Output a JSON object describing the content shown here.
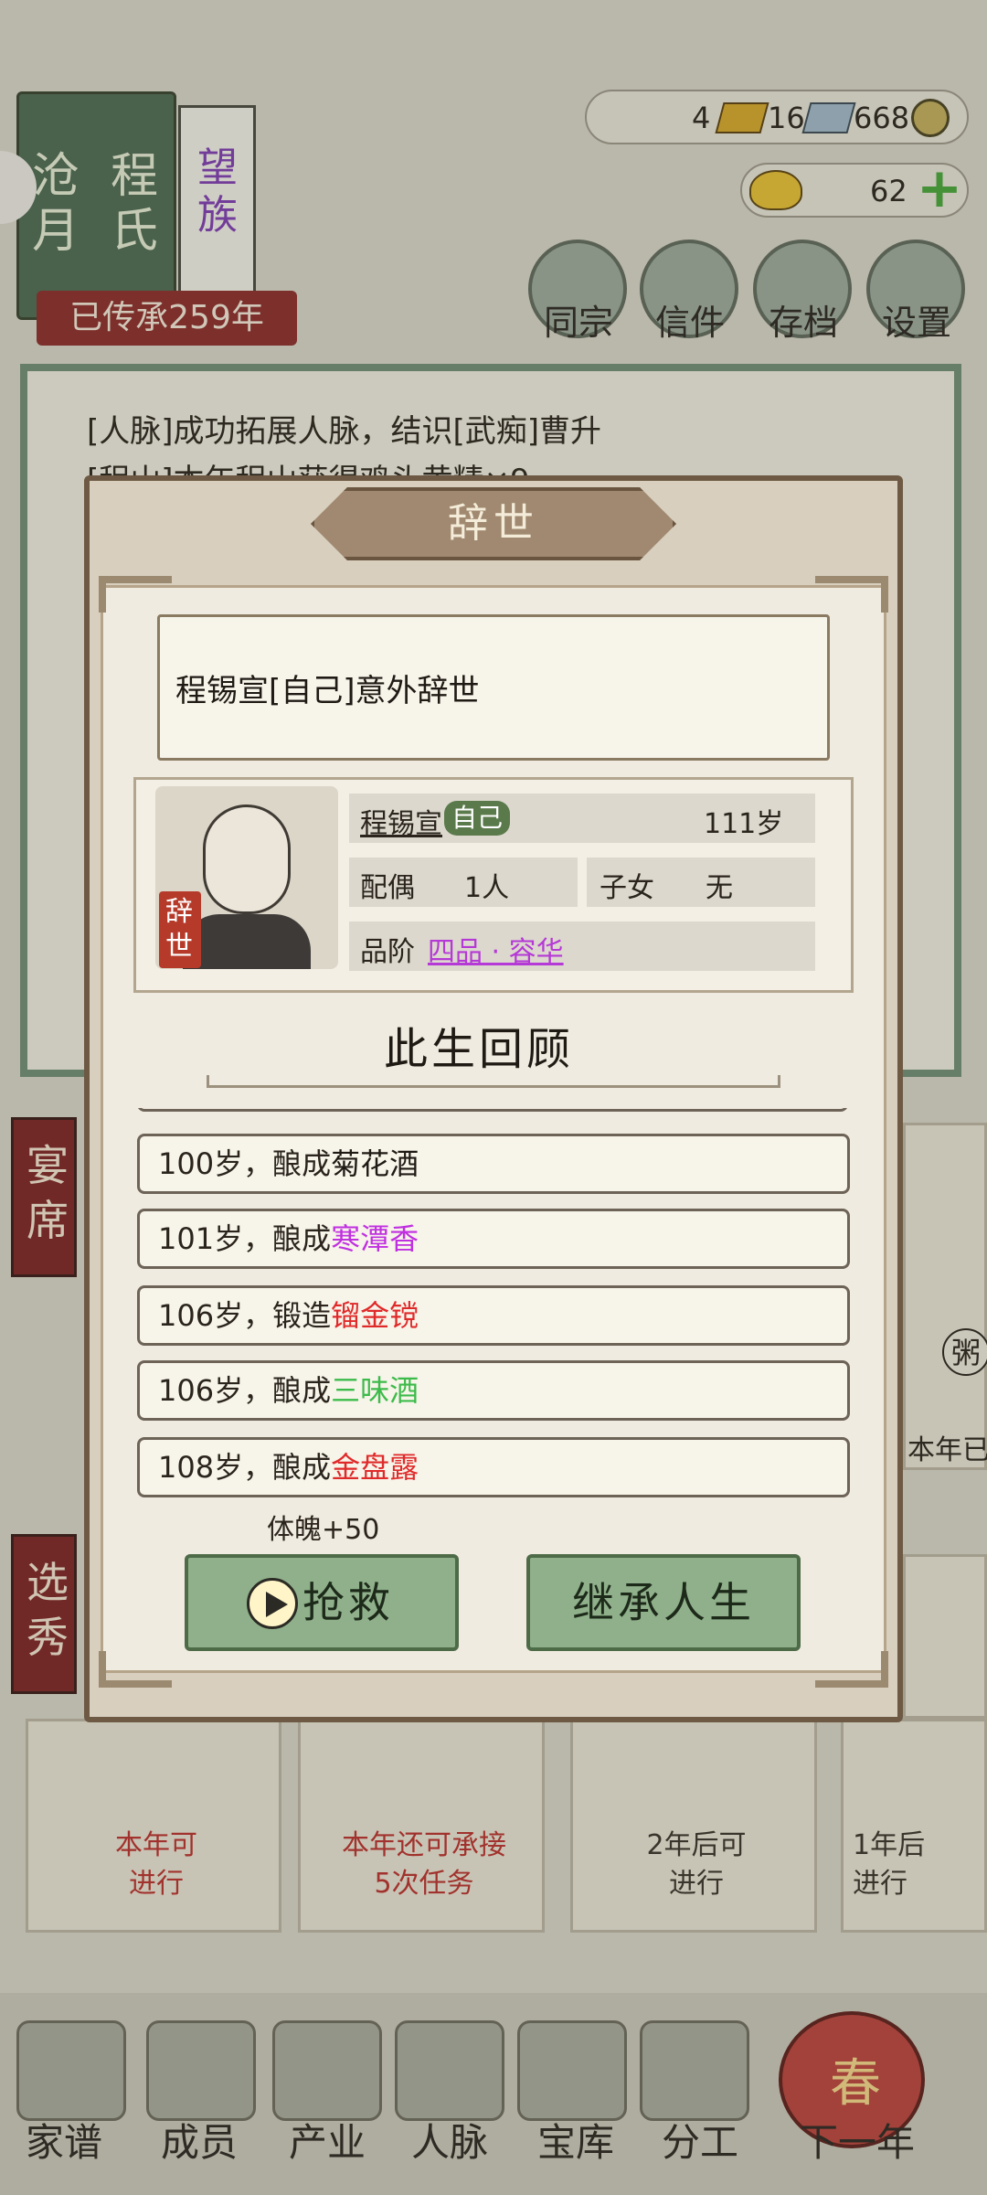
{
  "family": {
    "name_chars": [
      "沧月",
      "程氏"
    ],
    "clan_label": "望族",
    "inherit_label": "已传承259年"
  },
  "resources": {
    "res1": "4",
    "res2": "16",
    "res3": "668",
    "ingot": "62"
  },
  "top_buttons": [
    "同宗",
    "信件",
    "存档",
    "设置"
  ],
  "log_lines": [
    "[人脉]成功拓展人脉，结识[武痴]曹升",
    "[程山]本年程山获得鸡头黄精×9"
  ],
  "side_tabs": [
    {
      "label": "宴席"
    },
    {
      "label": "选秀"
    }
  ],
  "bg_right_texts": [
    "粥",
    "本年已"
  ],
  "task_cards": [
    {
      "line1": "本年可",
      "line2": "进行"
    },
    {
      "line1": "本年还可承接",
      "line2": "5次任务"
    },
    {
      "line1": "2年后可",
      "line2": "进行"
    },
    {
      "line1": "1年后",
      "line2": "进行"
    }
  ],
  "bottom_nav": [
    "家谱",
    "成员",
    "产业",
    "人脉",
    "宝库",
    "分工",
    "下一年"
  ],
  "season_badge": "春",
  "dialog": {
    "title": "辞世",
    "notice": "程锡宣[自己]意外辞世",
    "deceased_tag": "辞世",
    "profile": {
      "name": "程锡宣",
      "self_badge": "自己",
      "age": "111岁",
      "spouse_label": "配偶",
      "spouse_value": "1人",
      "children_label": "子女",
      "children_value": "无",
      "rank_label": "品阶",
      "rank_value": "四品 · 容华"
    },
    "review_title": "此生回顾",
    "life_events": [
      {
        "age": "100岁",
        "action": "，酿成",
        "item": "菊花酒",
        "color": "#1f1a14"
      },
      {
        "age": "101岁",
        "action": "，酿成",
        "item": "寒潭香",
        "color": "#c030e0"
      },
      {
        "age": "106岁",
        "action": "，锻造",
        "item": "镏金镋",
        "color": "#e02a2a"
      },
      {
        "age": "106岁",
        "action": "，酿成",
        "item": "三味酒",
        "color": "#3dbb4a"
      },
      {
        "age": "108岁",
        "action": "，酿成",
        "item": "金盘露",
        "color": "#e02a2a"
      }
    ],
    "bonus": "体魄+50",
    "rescue_button": "抢救",
    "inherit_button": "继承人生"
  }
}
